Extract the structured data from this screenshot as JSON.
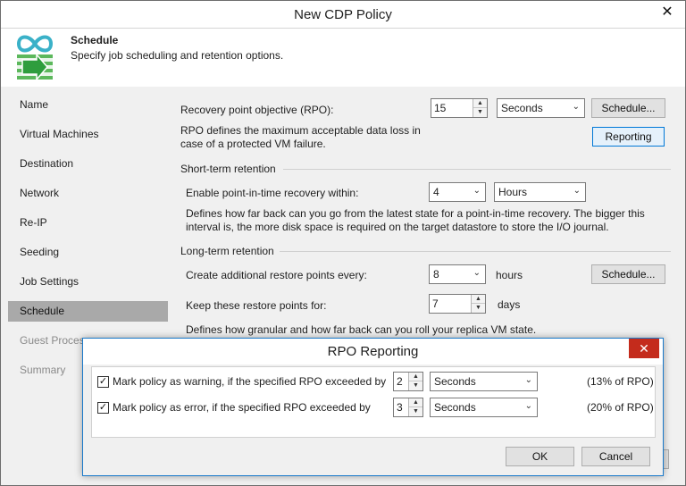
{
  "window": {
    "title": "New CDP Policy",
    "close_glyph": "✕"
  },
  "header": {
    "title": "Schedule",
    "subtitle": "Specify job scheduling and retention options."
  },
  "sidebar": {
    "items": [
      {
        "label": "Name"
      },
      {
        "label": "Virtual Machines"
      },
      {
        "label": "Destination"
      },
      {
        "label": "Network"
      },
      {
        "label": "Re-IP"
      },
      {
        "label": "Seeding"
      },
      {
        "label": "Job Settings"
      },
      {
        "label": "Schedule"
      },
      {
        "label": "Guest Proces"
      },
      {
        "label": "Summary"
      }
    ],
    "active": "Schedule"
  },
  "rpo": {
    "label": "Recovery point objective (RPO):",
    "value": "15",
    "unit": "Seconds",
    "schedule_button": "Schedule...",
    "reporting_button": "Reporting",
    "description_line1": "RPO defines the maximum acceptable data loss in",
    "description_line2": "case of a protected VM failure."
  },
  "short_term": {
    "section_title": "Short-term retention",
    "label": "Enable point-in-time recovery within:",
    "value": "4",
    "unit": "Hours",
    "description_line1": "Defines how far back can you go from the latest state for a point-in-time recovery. The bigger this",
    "description_line2": "interval is, the more disk space is required on the target datastore to store the I/O journal."
  },
  "long_term": {
    "section_title": "Long-term retention",
    "create_label": "Create additional restore points every:",
    "create_value": "8",
    "create_unit": "hours",
    "schedule_button": "Schedule...",
    "keep_label": "Keep these restore points for:",
    "keep_value": "7",
    "keep_unit": "days",
    "description": "Defines how granular and how far back can you roll your replica VM state."
  },
  "dialog": {
    "title": "RPO Reporting",
    "close_glyph": "✕",
    "warning": {
      "checked": true,
      "label": "Mark policy as warning, if the specified RPO exceeded by",
      "value": "2",
      "unit": "Seconds",
      "percent": "(13% of RPO)"
    },
    "error": {
      "checked": true,
      "label": "Mark policy as error, if the specified RPO exceeded by",
      "value": "3",
      "unit": "Seconds",
      "percent": "(20% of RPO)"
    },
    "ok_button": "OK",
    "cancel_button": "Cancel"
  },
  "glyphs": {
    "check": "✓",
    "chevron": "⌄",
    "arrow_up": "▲",
    "arrow_down": "▼"
  },
  "colors": {
    "accent": "#1979ca",
    "selected_item": "#a9a9a9",
    "close_red": "#c42b1c",
    "logo_teal": "#3ab1c8",
    "logo_green": "#5cb85c"
  }
}
